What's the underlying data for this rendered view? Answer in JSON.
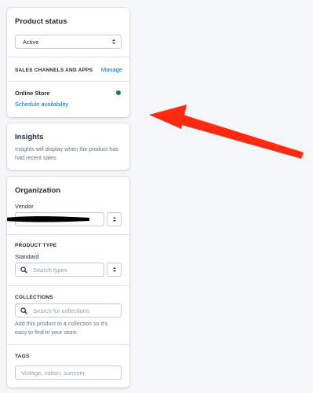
{
  "product_status": {
    "title": "Product status",
    "status_select": {
      "value": "Active"
    },
    "sales_channels_heading": "SALES CHANNELS AND APPS",
    "manage_link": "Manage",
    "online_store_label": "Online Store",
    "schedule_link": "Schedule availability",
    "status_dot_color": "#108043"
  },
  "insights": {
    "title": "Insights",
    "description": "Insights will display when the product has had recent sales"
  },
  "organization": {
    "title": "Organization",
    "vendor_label": "Vendor",
    "product_type_heading": "PRODUCT TYPE",
    "product_type_value": "Standard",
    "search_types_placeholder": "Search types",
    "collections_heading": "COLLECTIONS",
    "search_collections_placeholder": "Search for collections",
    "collections_help": "Add this product to a collection so it's easy to find in your store.",
    "tags_heading": "TAGS",
    "tags_placeholder": "Vintage, cotton, summer"
  },
  "annotation": {
    "arrow_color": "#ff2a10"
  }
}
